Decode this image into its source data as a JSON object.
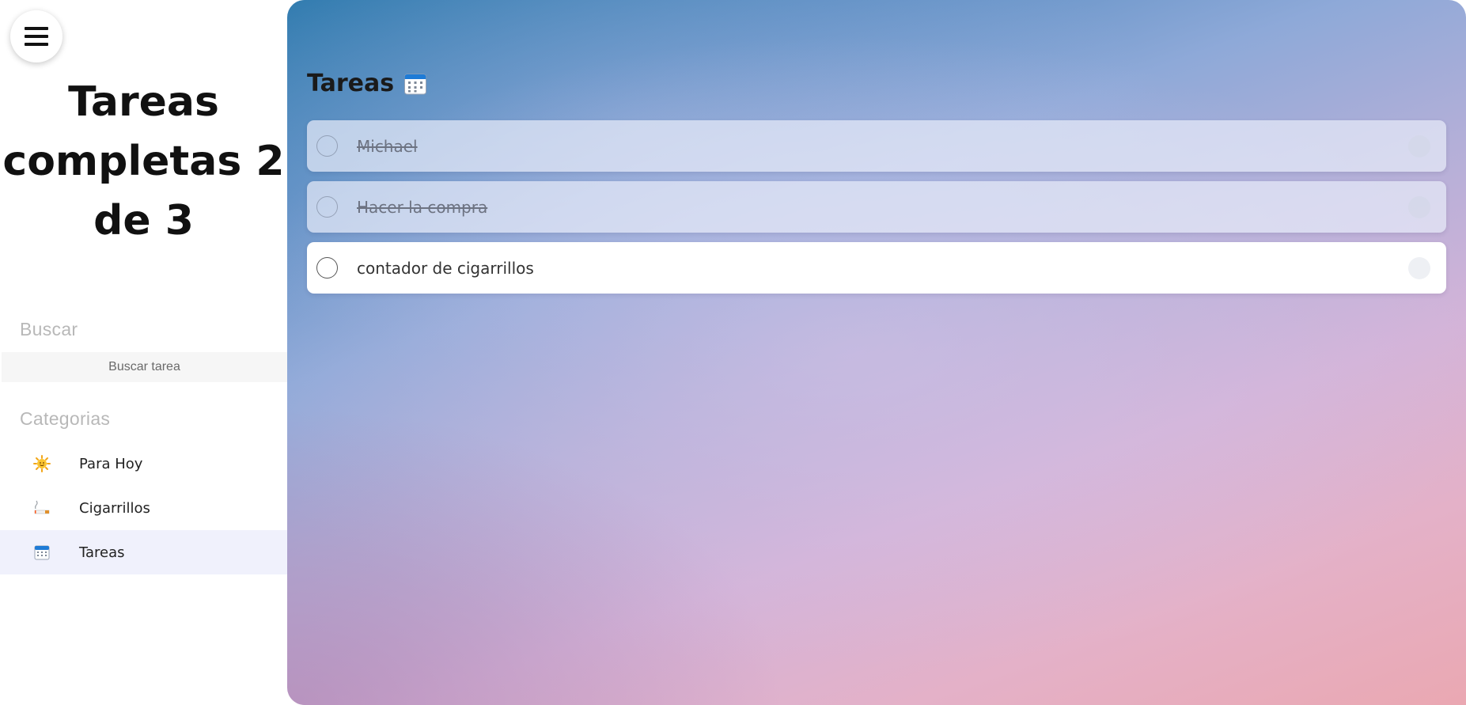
{
  "sidebar": {
    "progress_title": "Tareas completas 2 de 3",
    "search_section_label": "Buscar",
    "search_placeholder": "Buscar tarea",
    "categories_section_label": "Categorias",
    "categories": [
      {
        "label": "Para Hoy",
        "icon": "sun-icon",
        "active": false
      },
      {
        "label": "Cigarrillos",
        "icon": "cigarette-icon",
        "active": false
      },
      {
        "label": "Tareas",
        "icon": "calendar-icon",
        "active": true
      }
    ]
  },
  "main": {
    "title": "Tareas",
    "title_icon": "calendar-icon",
    "tasks": [
      {
        "text": "Michael",
        "completed": true
      },
      {
        "text": "Hacer la compra",
        "completed": true
      },
      {
        "text": "contador de cigarrillos",
        "completed": false
      }
    ],
    "add_button_label": "+"
  },
  "colors": {
    "accent": "#2c63d2",
    "active_category_bg": "#f0f1fc",
    "section_label": "#b8b8b8"
  }
}
